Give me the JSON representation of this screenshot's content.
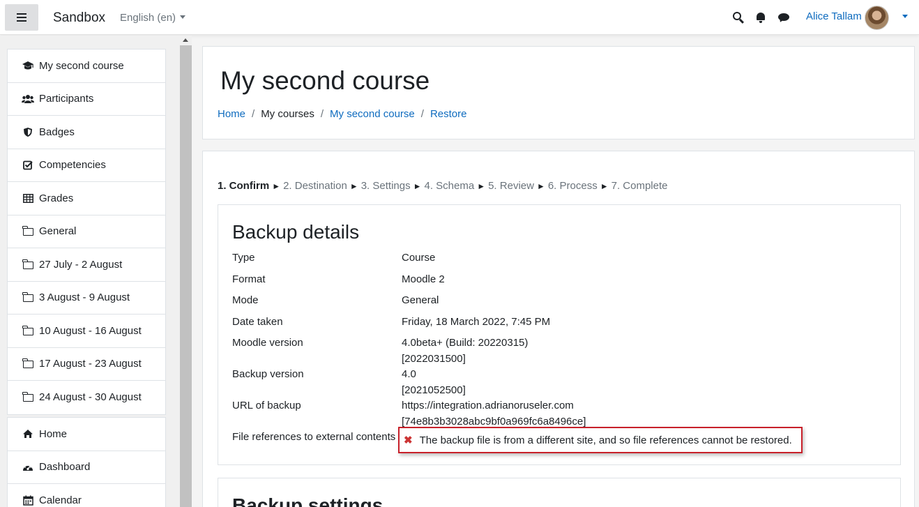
{
  "navbar": {
    "brand": "Sandbox",
    "language": "English ‎(en)‎",
    "user_name": "Alice Tallam"
  },
  "drawer": {
    "course_items": [
      {
        "label": "My second course",
        "icon": "graduation-cap-icon"
      },
      {
        "label": "Participants",
        "icon": "users-icon"
      },
      {
        "label": "Badges",
        "icon": "shield-icon"
      },
      {
        "label": "Competencies",
        "icon": "check-square-icon"
      },
      {
        "label": "Grades",
        "icon": "table-icon"
      },
      {
        "label": "General",
        "icon": "folder-icon"
      },
      {
        "label": "27 July - 2 August",
        "icon": "folder-icon"
      },
      {
        "label": "3 August - 9 August",
        "icon": "folder-icon"
      },
      {
        "label": "10 August - 16 August",
        "icon": "folder-icon"
      },
      {
        "label": "17 August - 23 August",
        "icon": "folder-icon"
      },
      {
        "label": "24 August - 30 August",
        "icon": "folder-icon"
      }
    ],
    "site_items": [
      {
        "label": "Home",
        "icon": "home-icon"
      },
      {
        "label": "Dashboard",
        "icon": "dashboard-icon"
      },
      {
        "label": "Calendar",
        "icon": "calendar-icon"
      }
    ]
  },
  "header": {
    "title": "My second course",
    "breadcrumb": [
      {
        "label": "Home",
        "link": true
      },
      {
        "label": "My courses",
        "link": false
      },
      {
        "label": "My second course",
        "link": true
      },
      {
        "label": "Restore",
        "link": true
      }
    ]
  },
  "steps": {
    "items": [
      "1. Confirm",
      "2. Destination",
      "3. Settings",
      "4. Schema",
      "5. Review",
      "6. Process",
      "7. Complete"
    ],
    "arrow": "►"
  },
  "backup_details": {
    "title": "Backup details",
    "rows": [
      {
        "label": "Type",
        "value": "Course"
      },
      {
        "label": "Format",
        "value": "Moodle 2"
      },
      {
        "label": "Mode",
        "value": "General"
      },
      {
        "label": "Date taken",
        "value": "Friday, 18 March 2022, 7:45 PM"
      },
      {
        "label": "Moodle version",
        "value": "4.0beta+ (Build: 20220315)",
        "value2": "[2022031500]"
      },
      {
        "label": "Backup version",
        "value": "4.0",
        "value2": "[2021052500]"
      },
      {
        "label": "URL of backup",
        "value": "https://integration.adrianoruseler.com",
        "value2": "[74e8b3b3028abc9bf0a969fc6a8496ce]"
      }
    ],
    "file_refs_label": "File references to external contents",
    "file_refs_error": "The backup file is from a different site, and so file references cannot be restored.",
    "error_icon": "✖"
  },
  "backup_settings": {
    "title": "Backup settings"
  }
}
